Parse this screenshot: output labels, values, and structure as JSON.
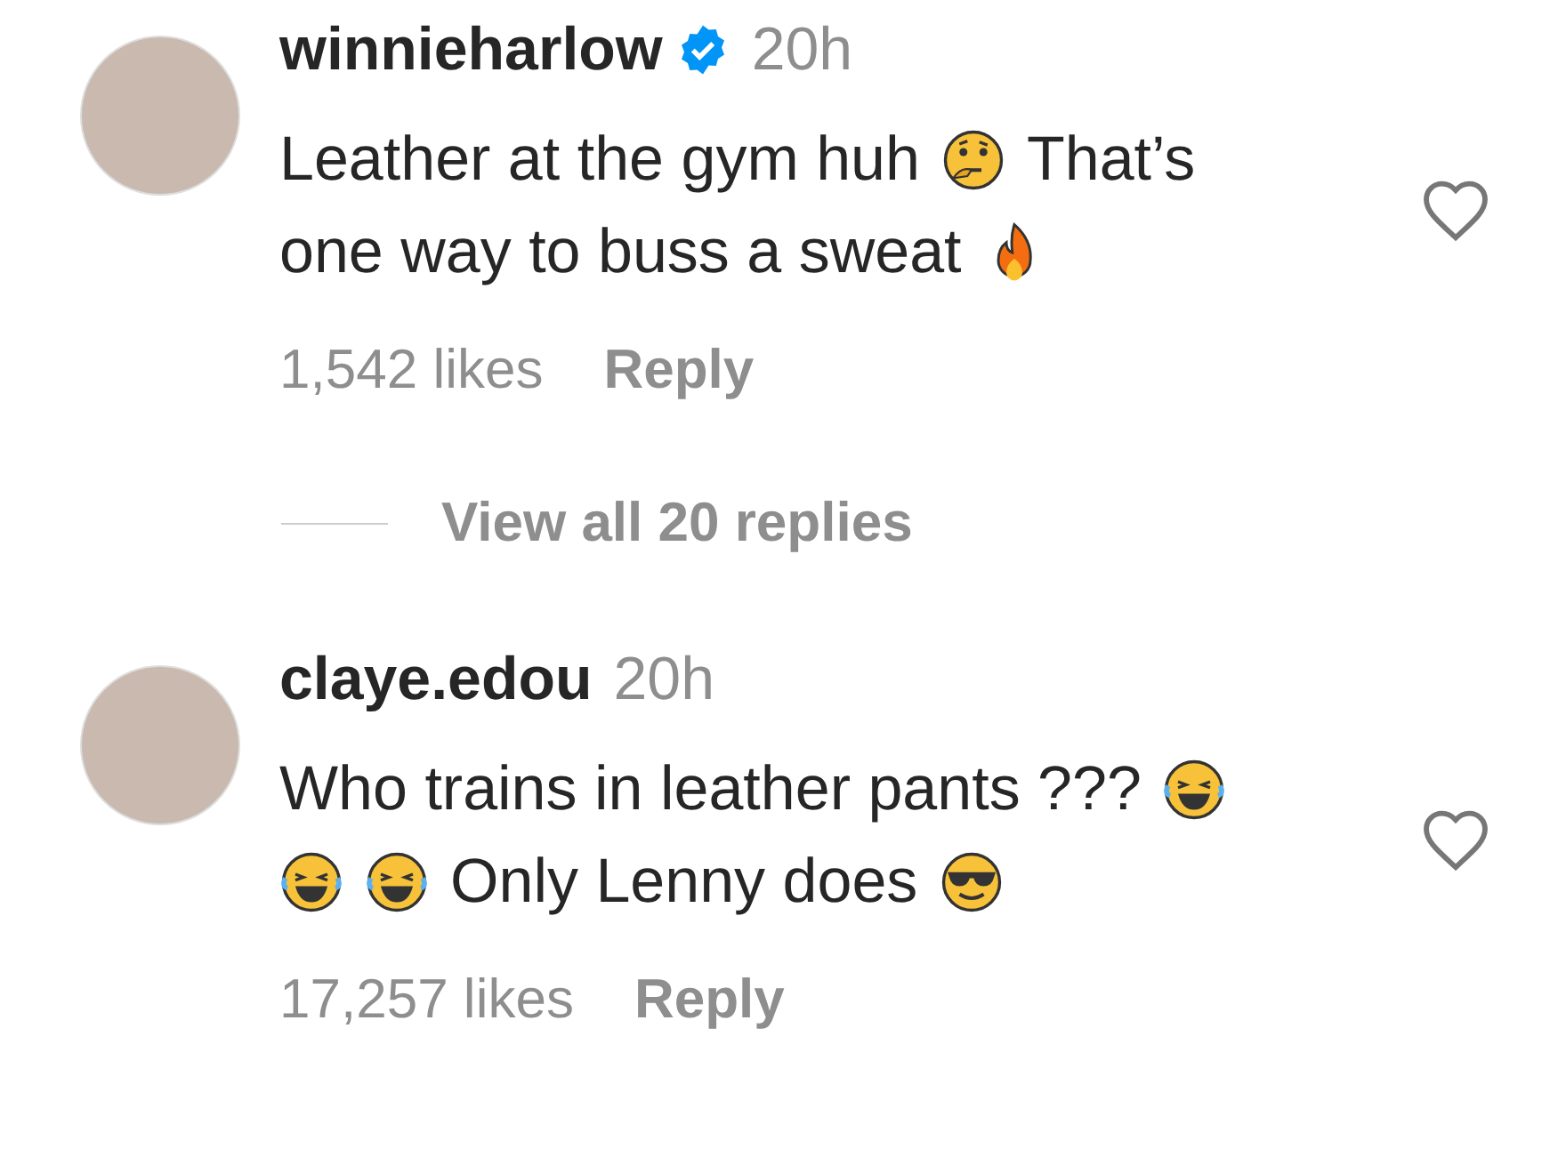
{
  "comments": [
    {
      "username": "winnieharlow",
      "verified": true,
      "time": "20h",
      "lines": [
        [
          {
            "kind": "text",
            "text": "Leather at the gym huh"
          },
          {
            "kind": "thinking-emoji"
          },
          {
            "kind": "text",
            "text": "That’s"
          }
        ],
        [
          {
            "kind": "text",
            "text": "one way to buss a sweat"
          },
          {
            "kind": "fire-emoji"
          }
        ]
      ],
      "likes": "1,542 likes",
      "reply": "Reply",
      "view_replies": "View all 20 replies"
    },
    {
      "username": "claye.edou",
      "time": "20h",
      "lines": [
        [
          {
            "kind": "text",
            "text": "Who trains in leather pants ???"
          },
          {
            "kind": "laughing-emoji"
          }
        ],
        [
          {
            "kind": "laughing-emoji"
          },
          {
            "kind": "laughing-emoji"
          },
          {
            "kind": "text",
            "text": "Only Lenny does"
          },
          {
            "kind": "cool-emoji"
          }
        ]
      ],
      "likes": "17,257 likes",
      "reply": "Reply"
    }
  ]
}
